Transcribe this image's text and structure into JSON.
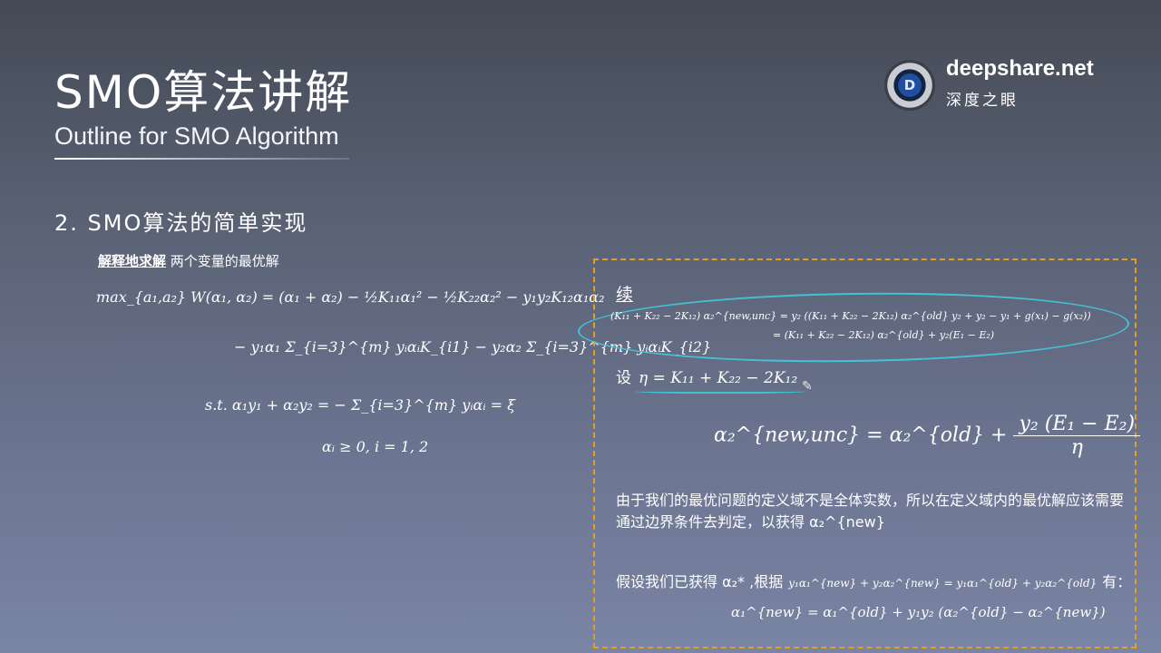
{
  "header": {
    "title": "SMO算法讲解",
    "subtitle": "Outline for SMO Algorithm"
  },
  "brand": {
    "logo_letter": "D",
    "site": "deepshare.net",
    "name_cn": "深度之眼"
  },
  "section": {
    "heading": "2. SMO算法的简单实现",
    "intro_strong": "解释地求解",
    "intro_rest": " 两个变量的最优解"
  },
  "left_math": {
    "line1": "max_{a₁,a₂} W(α₁, α₂) = (α₁ + α₂) − ½K₁₁α₁² − ½K₂₂α₂² − y₁y₂K₁₂α₁α₂",
    "line2": "− y₁α₁ Σ_{i=3}^{m} yᵢαᵢK_{i1} − y₂α₂ Σ_{i=3}^{m} yᵢαᵢK_{i2}",
    "line3": "s.t.   α₁y₁ + α₂y₂ = − Σ_{i=3}^{m} yᵢαᵢ = ξ",
    "line4": "αᵢ ≥ 0,   i = 1, 2"
  },
  "box": {
    "continued_label": "续",
    "eq_line1": "(K₁₁ + K₂₂ − 2K₁₂) α₂^{new,unc} = y₂ ((K₁₁ + K₂₂ − 2K₁₂) α₂^{old} y₂ + y₂ − y₁ + g(x₁) − g(x₂))",
    "eq_line2": "= (K₁₁ + K₂₂ − 2K₁₂) α₂^{old} + y₂(E₁ − E₂)",
    "eta_label": "设",
    "eta_def": "η = K₁₁ + K₂₂ − 2K₁₂",
    "update_lhs": "α₂^{new,unc} = α₂^{old} +",
    "update_num": "y₂ (E₁ − E₂)",
    "update_den": "η",
    "para1": "由于我们的最优问题的定义域不是全体实数，所以在定义域内的最优解应该需要通过边界条件去判定，以获得 α₂^{new}",
    "para2_a": "假设我们已获得 α₂* ,根据",
    "para2_math": "y₁α₁^{new} + y₂α₂^{new} = y₁α₁^{old} + y₂α₂^{old}",
    "para2_b": "有：",
    "final_eq": "α₁^{new} = α₁^{old} + y₁y₂ (α₂^{old} − α₂^{new})"
  },
  "colors": {
    "box_border": "#e0a024",
    "annotation": "#46c1d3"
  },
  "icons": {
    "pen": "pen-icon"
  }
}
